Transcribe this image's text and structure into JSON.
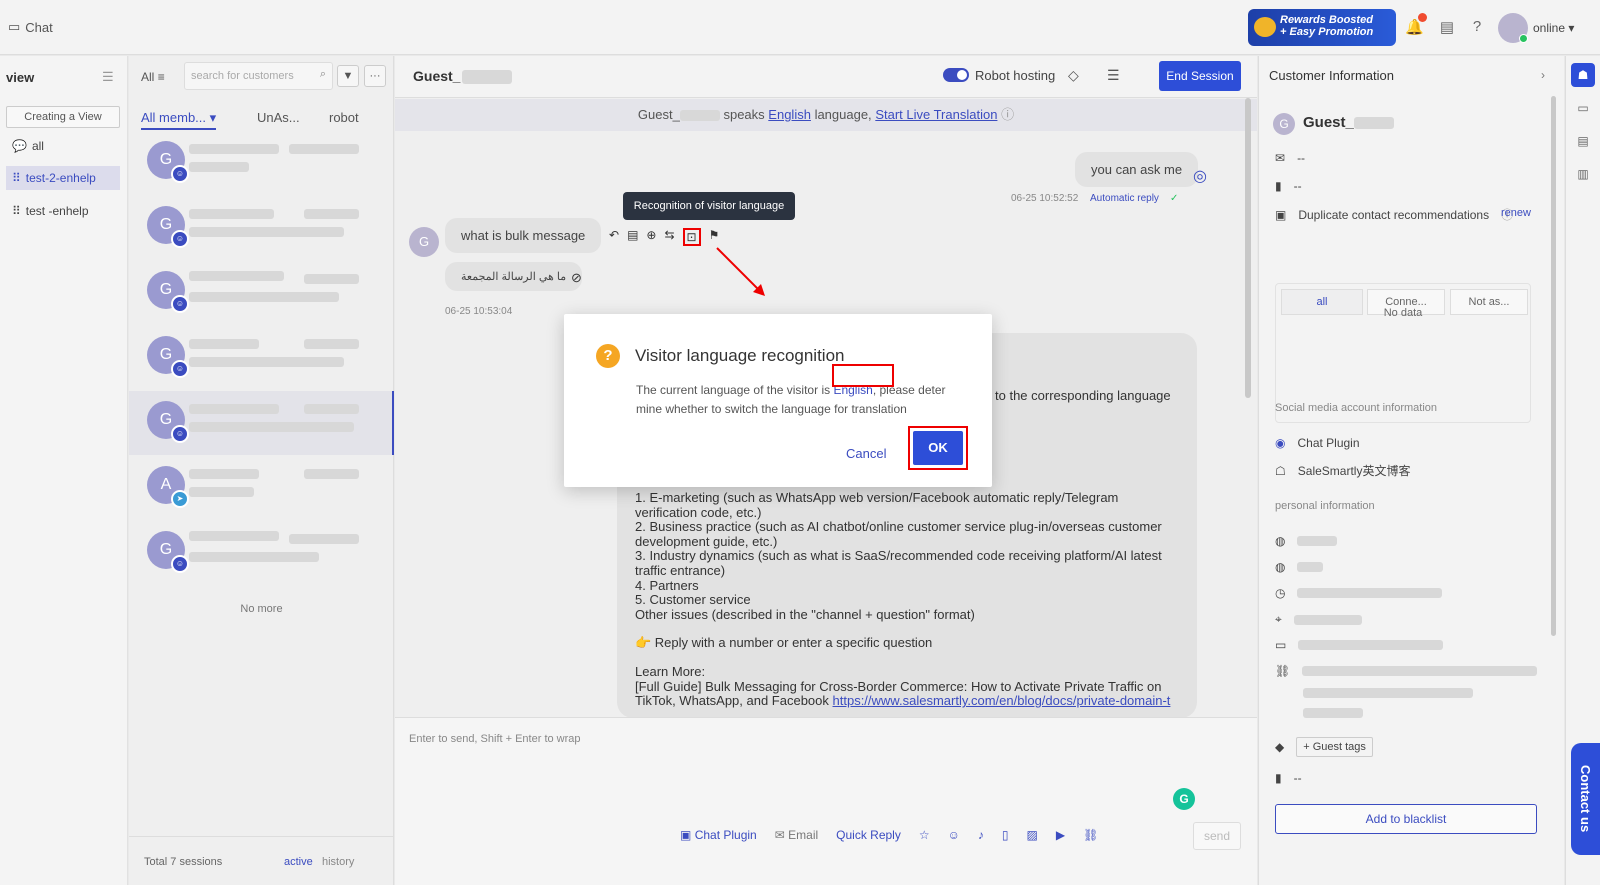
{
  "topbar": {
    "app_title": "Chat",
    "promo_line1": "Rewards Boosted",
    "promo_line2": "+ Easy Promotion",
    "status": "online"
  },
  "nav": {
    "title": "view",
    "create_view": "Creating a View",
    "items": [
      {
        "label": "all"
      },
      {
        "label": "test-2-enhelp"
      },
      {
        "label": "test -enhelp"
      }
    ]
  },
  "sessions": {
    "filter_label": "All",
    "search_placeholder": "search for customers",
    "tabs": [
      "All memb...",
      "UnAs...",
      "robot"
    ],
    "avatars": [
      "G",
      "G",
      "G",
      "G",
      "G",
      "A",
      "G"
    ],
    "no_more": "No more",
    "total": "Total 7 sessions",
    "active": "active",
    "history": "history"
  },
  "chat": {
    "name": "Guest_",
    "robot_hosting": "Robot hosting",
    "end_session": "End Session",
    "lang_bar": {
      "prefix": "Guest_",
      "speaks": "speaks",
      "language_name": "English",
      "language_word": "language,",
      "live_translation": "Start Live Translation"
    },
    "outgoing_msg": "you can ask me",
    "outgoing_time": "06-25 10:52:52",
    "auto_reply": "Automatic reply",
    "incoming_avatar": "G",
    "incoming_msg": "what is bulk message",
    "translation": "ما هي الرسالة المجمعة",
    "incoming_time": "06-25 10:53:04",
    "tooltip": "Recognition of visitor language",
    "long_partial": "to the corresponding language",
    "long_lines": [
      "1. E-marketing (such as WhatsApp web version/Facebook automatic reply/Telegram verification code, etc.)",
      "2. Business practice (such as AI chatbot/online customer service plug-in/overseas customer development guide, etc.)",
      "3. Industry dynamics (such as what is SaaS/recommended code receiving platform/AI latest traffic entrance)",
      "4. Partners",
      "5. Customer service",
      "Other issues (described in the \"channel + question\" format)"
    ],
    "reply_hint": "👉 Reply with a number or enter a specific question",
    "learn_more": "Learn More:",
    "full_guide": "[Full Guide] Bulk Messaging for Cross-Border Commerce: How to Activate Private Traffic on TikTok, WhatsApp, and Facebook",
    "guide_url": "https://www.salesmartly.com/en/blog/docs/private-domain-t",
    "composer_hint": "Enter to send, Shift + Enter to wrap",
    "tools": {
      "chat_plugin": "Chat Plugin",
      "email": "Email",
      "quick_reply": "Quick Reply"
    },
    "send": "send"
  },
  "info": {
    "title": "Customer Information",
    "avatar": "G",
    "name": "Guest_",
    "email": "--",
    "phone": "--",
    "dup_label": "Duplicate contact recommendations",
    "renew": "renew",
    "segments": [
      "all",
      "Conne...",
      "Not as..."
    ],
    "no_data": "No data",
    "social_label": "Social media account information",
    "chat_plugin": "Chat Plugin",
    "account_name": "SaleSmartly英文博客",
    "personal_label": "personal information",
    "guest_tags": "+ Guest tags",
    "tag_value": "--",
    "blacklist": "Add to blacklist",
    "contact_us": "Contact us"
  },
  "modal": {
    "title": "Visitor language recognition",
    "body_prefix": "The current language of the visitor is",
    "body_language": "English",
    "body_suffix": ", please deter mine whether to switch the language for translation",
    "cancel": "Cancel",
    "ok": "OK"
  },
  "colors": {
    "accent": "#2d4ed8",
    "highlight": "#e00000",
    "warning": "#f5a623"
  }
}
